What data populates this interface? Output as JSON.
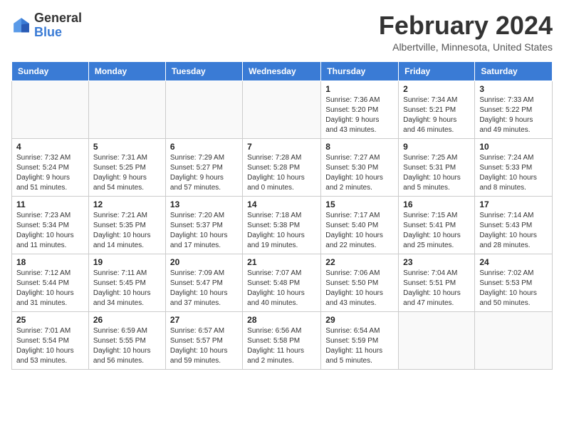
{
  "app": {
    "logo_general": "General",
    "logo_blue": "Blue"
  },
  "header": {
    "month": "February 2024",
    "location": "Albertville, Minnesota, United States"
  },
  "weekdays": [
    "Sunday",
    "Monday",
    "Tuesday",
    "Wednesday",
    "Thursday",
    "Friday",
    "Saturday"
  ],
  "weeks": [
    [
      {
        "day": "",
        "info": ""
      },
      {
        "day": "",
        "info": ""
      },
      {
        "day": "",
        "info": ""
      },
      {
        "day": "",
        "info": ""
      },
      {
        "day": "1",
        "info": "Sunrise: 7:36 AM\nSunset: 5:20 PM\nDaylight: 9 hours\nand 43 minutes."
      },
      {
        "day": "2",
        "info": "Sunrise: 7:34 AM\nSunset: 5:21 PM\nDaylight: 9 hours\nand 46 minutes."
      },
      {
        "day": "3",
        "info": "Sunrise: 7:33 AM\nSunset: 5:22 PM\nDaylight: 9 hours\nand 49 minutes."
      }
    ],
    [
      {
        "day": "4",
        "info": "Sunrise: 7:32 AM\nSunset: 5:24 PM\nDaylight: 9 hours\nand 51 minutes."
      },
      {
        "day": "5",
        "info": "Sunrise: 7:31 AM\nSunset: 5:25 PM\nDaylight: 9 hours\nand 54 minutes."
      },
      {
        "day": "6",
        "info": "Sunrise: 7:29 AM\nSunset: 5:27 PM\nDaylight: 9 hours\nand 57 minutes."
      },
      {
        "day": "7",
        "info": "Sunrise: 7:28 AM\nSunset: 5:28 PM\nDaylight: 10 hours\nand 0 minutes."
      },
      {
        "day": "8",
        "info": "Sunrise: 7:27 AM\nSunset: 5:30 PM\nDaylight: 10 hours\nand 2 minutes."
      },
      {
        "day": "9",
        "info": "Sunrise: 7:25 AM\nSunset: 5:31 PM\nDaylight: 10 hours\nand 5 minutes."
      },
      {
        "day": "10",
        "info": "Sunrise: 7:24 AM\nSunset: 5:33 PM\nDaylight: 10 hours\nand 8 minutes."
      }
    ],
    [
      {
        "day": "11",
        "info": "Sunrise: 7:23 AM\nSunset: 5:34 PM\nDaylight: 10 hours\nand 11 minutes."
      },
      {
        "day": "12",
        "info": "Sunrise: 7:21 AM\nSunset: 5:35 PM\nDaylight: 10 hours\nand 14 minutes."
      },
      {
        "day": "13",
        "info": "Sunrise: 7:20 AM\nSunset: 5:37 PM\nDaylight: 10 hours\nand 17 minutes."
      },
      {
        "day": "14",
        "info": "Sunrise: 7:18 AM\nSunset: 5:38 PM\nDaylight: 10 hours\nand 19 minutes."
      },
      {
        "day": "15",
        "info": "Sunrise: 7:17 AM\nSunset: 5:40 PM\nDaylight: 10 hours\nand 22 minutes."
      },
      {
        "day": "16",
        "info": "Sunrise: 7:15 AM\nSunset: 5:41 PM\nDaylight: 10 hours\nand 25 minutes."
      },
      {
        "day": "17",
        "info": "Sunrise: 7:14 AM\nSunset: 5:43 PM\nDaylight: 10 hours\nand 28 minutes."
      }
    ],
    [
      {
        "day": "18",
        "info": "Sunrise: 7:12 AM\nSunset: 5:44 PM\nDaylight: 10 hours\nand 31 minutes."
      },
      {
        "day": "19",
        "info": "Sunrise: 7:11 AM\nSunset: 5:45 PM\nDaylight: 10 hours\nand 34 minutes."
      },
      {
        "day": "20",
        "info": "Sunrise: 7:09 AM\nSunset: 5:47 PM\nDaylight: 10 hours\nand 37 minutes."
      },
      {
        "day": "21",
        "info": "Sunrise: 7:07 AM\nSunset: 5:48 PM\nDaylight: 10 hours\nand 40 minutes."
      },
      {
        "day": "22",
        "info": "Sunrise: 7:06 AM\nSunset: 5:50 PM\nDaylight: 10 hours\nand 43 minutes."
      },
      {
        "day": "23",
        "info": "Sunrise: 7:04 AM\nSunset: 5:51 PM\nDaylight: 10 hours\nand 47 minutes."
      },
      {
        "day": "24",
        "info": "Sunrise: 7:02 AM\nSunset: 5:53 PM\nDaylight: 10 hours\nand 50 minutes."
      }
    ],
    [
      {
        "day": "25",
        "info": "Sunrise: 7:01 AM\nSunset: 5:54 PM\nDaylight: 10 hours\nand 53 minutes."
      },
      {
        "day": "26",
        "info": "Sunrise: 6:59 AM\nSunset: 5:55 PM\nDaylight: 10 hours\nand 56 minutes."
      },
      {
        "day": "27",
        "info": "Sunrise: 6:57 AM\nSunset: 5:57 PM\nDaylight: 10 hours\nand 59 minutes."
      },
      {
        "day": "28",
        "info": "Sunrise: 6:56 AM\nSunset: 5:58 PM\nDaylight: 11 hours\nand 2 minutes."
      },
      {
        "day": "29",
        "info": "Sunrise: 6:54 AM\nSunset: 5:59 PM\nDaylight: 11 hours\nand 5 minutes."
      },
      {
        "day": "",
        "info": ""
      },
      {
        "day": "",
        "info": ""
      }
    ]
  ]
}
